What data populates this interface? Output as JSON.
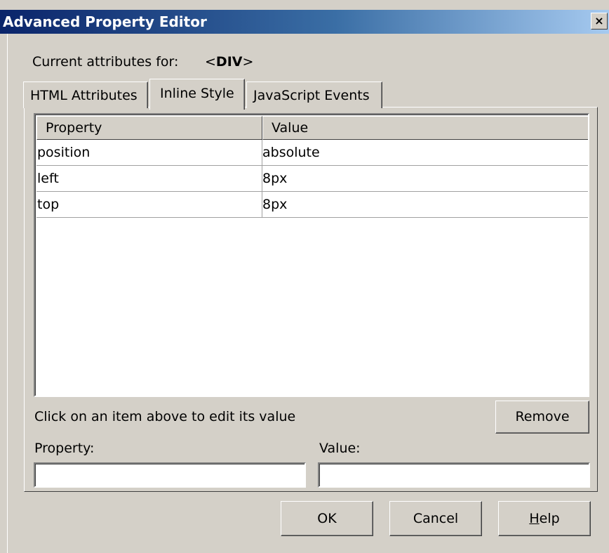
{
  "window": {
    "title": "Advanced Property Editor",
    "close_glyph": "×"
  },
  "current": {
    "label": "Current attributes for:",
    "tag_open": "<",
    "tag_name": "DIV",
    "tag_close": ">"
  },
  "tabs": [
    {
      "label": "HTML Attributes",
      "selected": false
    },
    {
      "label": "Inline Style",
      "selected": true
    },
    {
      "label": "JavaScript Events",
      "selected": false
    }
  ],
  "grid": {
    "columns": [
      "Property",
      "Value"
    ],
    "rows": [
      {
        "property": "position",
        "value": "absolute"
      },
      {
        "property": "left",
        "value": "8px"
      },
      {
        "property": "top",
        "value": "8px"
      }
    ]
  },
  "editor": {
    "hint": "Click on an item above to edit its value",
    "remove_label": "Remove",
    "property_label": "Property:",
    "value_label": "Value:",
    "property_value": "",
    "value_value": ""
  },
  "buttons": {
    "ok": "OK",
    "cancel": "Cancel",
    "help_mnemonic": "H",
    "help_rest": "elp"
  },
  "colors": {
    "titlebar_start": "#0a246a",
    "titlebar_end": "#a6caf0",
    "face": "#d4d0c8"
  }
}
